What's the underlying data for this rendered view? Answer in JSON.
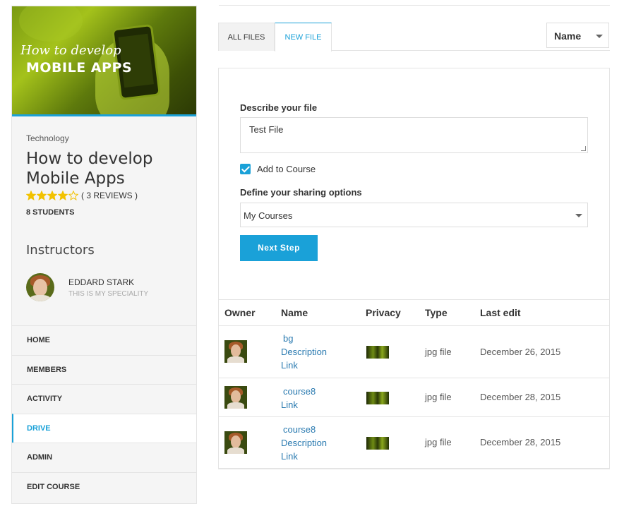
{
  "course": {
    "cover_line1": "How to develop",
    "cover_line2": "MOBILE APPS",
    "category": "Technology",
    "title": "How to develop Mobile Apps",
    "rating_stars": 4,
    "rating_max": 5,
    "reviews": "( 3 REVIEWS )",
    "students": "8 STUDENTS"
  },
  "instructors": {
    "heading": "Instructors",
    "name": "EDDARD STARK",
    "speciality": "THIS IS MY SPECIALITY"
  },
  "nav": {
    "items": [
      {
        "label": "HOME"
      },
      {
        "label": "MEMBERS"
      },
      {
        "label": "ACTIVITY"
      },
      {
        "label": "DRIVE"
      },
      {
        "label": "ADMIN"
      },
      {
        "label": "EDIT COURSE"
      }
    ],
    "active": "DRIVE"
  },
  "tabs": {
    "all_files": "ALL FILES",
    "new_file": "NEW FILE",
    "active": "NEW FILE"
  },
  "sort": {
    "selected": "Name"
  },
  "form": {
    "describe_label": "Describe your file",
    "describe_value": "Test File",
    "add_to_course_label": "Add to Course",
    "add_to_course_checked": true,
    "sharing_label": "Define your sharing options",
    "sharing_selected": "My Courses",
    "next_button": "Next Step"
  },
  "table": {
    "headers": {
      "owner": "Owner",
      "name": "Name",
      "privacy": "Privacy",
      "type": "Type",
      "last_edit": "Last edit"
    },
    "rows": [
      {
        "name_lines": [
          "bg",
          "Description",
          "Link"
        ],
        "type": "jpg file",
        "last_edit": "December 26, 2015"
      },
      {
        "name_lines": [
          "course8",
          "Link"
        ],
        "type": "jpg file",
        "last_edit": "December 28, 2015"
      },
      {
        "name_lines": [
          "course8",
          "Description",
          "Link"
        ],
        "type": "jpg file",
        "last_edit": "December 28, 2015"
      }
    ]
  },
  "colors": {
    "accent": "#1aa1d8",
    "star": "#f2c200",
    "link": "#2a7ab0"
  }
}
